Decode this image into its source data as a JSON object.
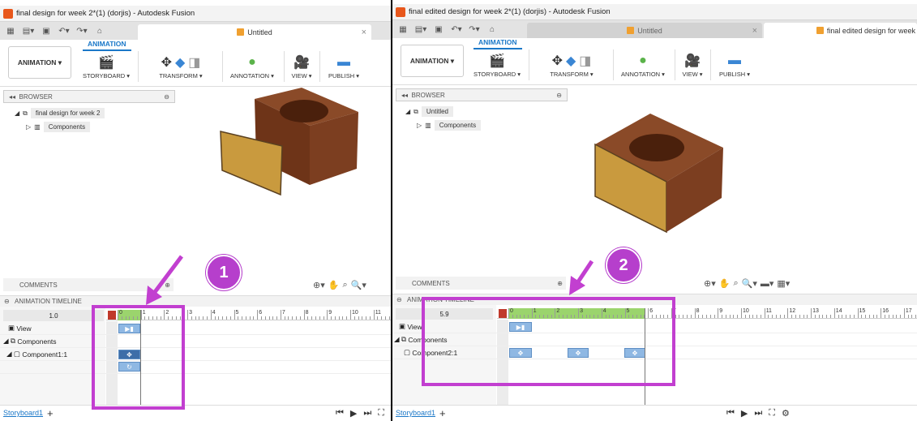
{
  "left": {
    "title": "final design for week 2*(1) (dorjis) - Autodesk Fusion",
    "tab_label": "Untitled",
    "ribbon_tab": "ANIMATION",
    "workspace": "ANIMATION",
    "groups": [
      "STORYBOARD",
      "TRANSFORM",
      "ANNOTATION",
      "VIEW",
      "PUBLISH"
    ],
    "browser_title": "BROWSER",
    "root_node": "final design for week 2",
    "components_node": "Components",
    "comments": "COMMENTS",
    "timeline_title": "ANIMATION TIMELINE",
    "time_value": "1.0",
    "ruler_labels": [
      "0",
      "1",
      "2",
      "3",
      "4",
      "5",
      "6",
      "7",
      "8",
      "9",
      "10",
      "11"
    ],
    "rows": {
      "view": "View",
      "components": "Components",
      "component": "Component1:1"
    },
    "storyboard": "Storyboard1",
    "badge": "1"
  },
  "right": {
    "title": "final edited design for week 2*(1) (dorjis) - Autodesk Fusion",
    "tab_label": "Untitled",
    "tab2_label": "final edited design for week",
    "ribbon_tab": "ANIMATION",
    "workspace": "ANIMATION",
    "groups": [
      "STORYBOARD",
      "TRANSFORM",
      "ANNOTATION",
      "VIEW",
      "PUBLISH"
    ],
    "browser_title": "BROWSER",
    "root_node": "Untitled",
    "components_node": "Components",
    "comments": "COMMENTS",
    "timeline_title": "ANIMATION TIMELINE",
    "time_value": "5.9",
    "ruler_labels": [
      "0",
      "1",
      "2",
      "3",
      "4",
      "5",
      "6",
      "7",
      "8",
      "9",
      "10",
      "11",
      "12",
      "13",
      "14",
      "15",
      "16",
      "17"
    ],
    "rows": {
      "view": "View",
      "components": "Components",
      "component": "Component2:1"
    },
    "storyboard": "Storyboard1",
    "badge": "2"
  },
  "colors": {
    "annotation": "#c23fd0",
    "playrange": "#9bd46d",
    "wood": "#7a3a1c",
    "panel": "#c99a3e",
    "accent": "#1b78c8"
  },
  "icons": [
    "app-grid-icon",
    "file-icon",
    "save-icon",
    "undo-icon",
    "redo-icon",
    "home-icon",
    "storyboard-icon",
    "move-icon",
    "transform-icon",
    "view-icon",
    "annotation-pin-icon",
    "camera-icon",
    "publish-icon",
    "camera-action-icon",
    "move-action-icon",
    "rotate-action-icon",
    "play-icon",
    "settings-icon"
  ]
}
